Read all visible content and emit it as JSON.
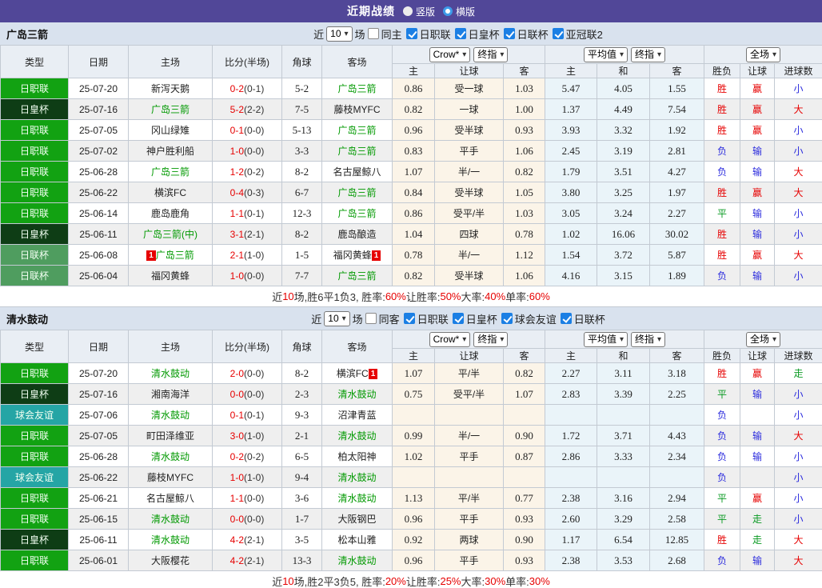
{
  "topbar": {
    "title": "近期战绩",
    "radio_selected_label": "竖版",
    "radio_unselected_label": "横版"
  },
  "columns": {
    "main": [
      "类型",
      "日期",
      "主场",
      "比分(半场)",
      "角球",
      "客场"
    ],
    "sub": [
      "主",
      "让球",
      "客",
      "主",
      "和",
      "客",
      "胜负",
      "让球",
      "进球数"
    ]
  },
  "badge_label": "1",
  "type_colors": {
    "日职联": "#12A212",
    "日皇杯": "#0E3D15",
    "日联杯": "#4F9D5F",
    "球会友谊": "#25A5A5"
  },
  "result_colors": {
    "r": "#E60000",
    "g": "#0A9A22",
    "b": "#2B2BDD"
  },
  "sections": [
    {
      "team": "广岛三箭",
      "filter": {
        "near_label": "近",
        "count": "10",
        "games_label": "场",
        "same_label": "同主",
        "same_checked": false,
        "leagues": [
          "日职联",
          "日皇杯",
          "日联杯",
          "亚冠联2"
        ]
      },
      "selects": {
        "odds": "Crow*",
        "odds_final": "终指",
        "avg": "平均值",
        "avg_final": "终指",
        "scope": "全场"
      },
      "rows": [
        {
          "t": "日职联",
          "d": "25-07-20",
          "h": "新泻天鹅",
          "hg": false,
          "hb": false,
          "s1": "0-2",
          "s2": "(0-1)",
          "c": "5-2",
          "a": "广岛三箭",
          "ag": true,
          "ab": false,
          "o": [
            "0.86",
            "受一球",
            "1.03"
          ],
          "v": [
            "5.47",
            "4.05",
            "1.55"
          ],
          "r": [
            [
              "胜",
              "r"
            ],
            [
              "赢",
              "r"
            ],
            [
              "小",
              "b"
            ]
          ]
        },
        {
          "t": "日皇杯",
          "d": "25-07-16",
          "h": "广岛三箭",
          "hg": true,
          "hb": false,
          "s1": "5-2",
          "s2": "(2-2)",
          "c": "7-5",
          "a": "藤枝MYFC",
          "ag": false,
          "ab": false,
          "o": [
            "0.82",
            "一球",
            "1.00"
          ],
          "v": [
            "1.37",
            "4.49",
            "7.54"
          ],
          "r": [
            [
              "胜",
              "r"
            ],
            [
              "赢",
              "r"
            ],
            [
              "大",
              "r"
            ]
          ]
        },
        {
          "t": "日职联",
          "d": "25-07-05",
          "h": "冈山绿雉",
          "hg": false,
          "hb": false,
          "s1": "0-1",
          "s2": "(0-0)",
          "c": "5-13",
          "a": "广岛三箭",
          "ag": true,
          "ab": false,
          "o": [
            "0.96",
            "受半球",
            "0.93"
          ],
          "v": [
            "3.93",
            "3.32",
            "1.92"
          ],
          "r": [
            [
              "胜",
              "r"
            ],
            [
              "赢",
              "r"
            ],
            [
              "小",
              "b"
            ]
          ]
        },
        {
          "t": "日职联",
          "d": "25-07-02",
          "h": "神户胜利船",
          "hg": false,
          "hb": false,
          "s1": "1-0",
          "s2": "(0-0)",
          "c": "3-3",
          "a": "广岛三箭",
          "ag": true,
          "ab": false,
          "o": [
            "0.83",
            "平手",
            "1.06"
          ],
          "v": [
            "2.45",
            "3.19",
            "2.81"
          ],
          "r": [
            [
              "负",
              "b"
            ],
            [
              "输",
              "b"
            ],
            [
              "小",
              "b"
            ]
          ]
        },
        {
          "t": "日职联",
          "d": "25-06-28",
          "h": "广岛三箭",
          "hg": true,
          "hb": false,
          "s1": "1-2",
          "s2": "(0-2)",
          "c": "8-2",
          "a": "名古屋鲸八",
          "ag": false,
          "ab": false,
          "o": [
            "1.07",
            "半/一",
            "0.82"
          ],
          "v": [
            "1.79",
            "3.51",
            "4.27"
          ],
          "r": [
            [
              "负",
              "b"
            ],
            [
              "输",
              "b"
            ],
            [
              "大",
              "r"
            ]
          ]
        },
        {
          "t": "日职联",
          "d": "25-06-22",
          "h": "横滨FC",
          "hg": false,
          "hb": false,
          "s1": "0-4",
          "s2": "(0-3)",
          "c": "6-7",
          "a": "广岛三箭",
          "ag": true,
          "ab": false,
          "o": [
            "0.84",
            "受半球",
            "1.05"
          ],
          "v": [
            "3.80",
            "3.25",
            "1.97"
          ],
          "r": [
            [
              "胜",
              "r"
            ],
            [
              "赢",
              "r"
            ],
            [
              "大",
              "r"
            ]
          ]
        },
        {
          "t": "日职联",
          "d": "25-06-14",
          "h": "鹿岛鹿角",
          "hg": false,
          "hb": false,
          "s1": "1-1",
          "s2": "(0-1)",
          "c": "12-3",
          "a": "广岛三箭",
          "ag": true,
          "ab": false,
          "o": [
            "0.86",
            "受平/半",
            "1.03"
          ],
          "v": [
            "3.05",
            "3.24",
            "2.27"
          ],
          "r": [
            [
              "平",
              "g"
            ],
            [
              "输",
              "b"
            ],
            [
              "小",
              "b"
            ]
          ]
        },
        {
          "t": "日皇杯",
          "d": "25-06-11",
          "h": "广岛三箭(中)",
          "hg": true,
          "hb": false,
          "s1": "3-1",
          "s2": "(2-1)",
          "c": "8-2",
          "a": "鹿岛酿造",
          "ag": false,
          "ab": false,
          "o": [
            "1.04",
            "四球",
            "0.78"
          ],
          "v": [
            "1.02",
            "16.06",
            "30.02"
          ],
          "r": [
            [
              "胜",
              "r"
            ],
            [
              "输",
              "b"
            ],
            [
              "小",
              "b"
            ]
          ]
        },
        {
          "t": "日联杯",
          "d": "25-06-08",
          "h": "广岛三箭",
          "hg": true,
          "hb": true,
          "s1": "2-1",
          "s2": "(1-0)",
          "c": "1-5",
          "a": "福冈黄蜂",
          "ag": false,
          "ab": true,
          "o": [
            "0.78",
            "半/一",
            "1.12"
          ],
          "v": [
            "1.54",
            "3.72",
            "5.87"
          ],
          "r": [
            [
              "胜",
              "r"
            ],
            [
              "赢",
              "r"
            ],
            [
              "大",
              "r"
            ]
          ]
        },
        {
          "t": "日联杯",
          "d": "25-06-04",
          "h": "福冈黄蜂",
          "hg": false,
          "hb": false,
          "s1": "1-0",
          "s2": "(0-0)",
          "c": "7-7",
          "a": "广岛三箭",
          "ag": true,
          "ab": false,
          "o": [
            "0.82",
            "受半球",
            "1.06"
          ],
          "v": [
            "4.16",
            "3.15",
            "1.89"
          ],
          "r": [
            [
              "负",
              "b"
            ],
            [
              "输",
              "b"
            ],
            [
              "小",
              "b"
            ]
          ]
        }
      ],
      "summary": [
        [
          "近",
          false
        ],
        [
          "10",
          true
        ],
        [
          "场,胜6平1负3, 胜率:",
          false
        ],
        [
          "60%",
          true
        ],
        [
          " 让胜率:",
          false
        ],
        [
          "50%",
          true
        ],
        [
          " 大率:",
          false
        ],
        [
          "40%",
          true
        ],
        [
          " 单率:",
          false
        ],
        [
          "60%",
          true
        ]
      ]
    },
    {
      "team": "清水鼓动",
      "filter": {
        "near_label": "近",
        "count": "10",
        "games_label": "场",
        "same_label": "同客",
        "same_checked": false,
        "leagues": [
          "日职联",
          "日皇杯",
          "球会友谊",
          "日联杯"
        ]
      },
      "selects": {
        "odds": "Crow*",
        "odds_final": "终指",
        "avg": "平均值",
        "avg_final": "终指",
        "scope": "全场"
      },
      "rows": [
        {
          "t": "日职联",
          "d": "25-07-20",
          "h": "清水鼓动",
          "hg": true,
          "hb": false,
          "s1": "2-0",
          "s2": "(0-0)",
          "c": "8-2",
          "a": "横滨FC",
          "ag": false,
          "ab": true,
          "o": [
            "1.07",
            "平/半",
            "0.82"
          ],
          "v": [
            "2.27",
            "3.11",
            "3.18"
          ],
          "r": [
            [
              "胜",
              "r"
            ],
            [
              "赢",
              "r"
            ],
            [
              "走",
              "g"
            ]
          ]
        },
        {
          "t": "日皇杯",
          "d": "25-07-16",
          "h": "湘南海洋",
          "hg": false,
          "hb": false,
          "s1": "0-0",
          "s2": "(0-0)",
          "c": "2-3",
          "a": "清水鼓动",
          "ag": true,
          "ab": false,
          "o": [
            "0.75",
            "受平/半",
            "1.07"
          ],
          "v": [
            "2.83",
            "3.39",
            "2.25"
          ],
          "r": [
            [
              "平",
              "g"
            ],
            [
              "输",
              "b"
            ],
            [
              "小",
              "b"
            ]
          ]
        },
        {
          "t": "球会友谊",
          "d": "25-07-06",
          "h": "清水鼓动",
          "hg": true,
          "hb": false,
          "s1": "0-1",
          "s2": "(0-1)",
          "c": "9-3",
          "a": "沼津青蓝",
          "ag": false,
          "ab": false,
          "o": [
            "",
            "",
            ""
          ],
          "v": [
            "",
            "",
            ""
          ],
          "r": [
            [
              "负",
              "b"
            ],
            null,
            [
              "小",
              "b"
            ]
          ]
        },
        {
          "t": "日职联",
          "d": "25-07-05",
          "h": "町田泽维亚",
          "hg": false,
          "hb": false,
          "s1": "3-0",
          "s2": "(1-0)",
          "c": "2-1",
          "a": "清水鼓动",
          "ag": true,
          "ab": false,
          "o": [
            "0.99",
            "半/一",
            "0.90"
          ],
          "v": [
            "1.72",
            "3.71",
            "4.43"
          ],
          "r": [
            [
              "负",
              "b"
            ],
            [
              "输",
              "b"
            ],
            [
              "大",
              "r"
            ]
          ]
        },
        {
          "t": "日职联",
          "d": "25-06-28",
          "h": "清水鼓动",
          "hg": true,
          "hb": false,
          "s1": "0-2",
          "s2": "(0-2)",
          "c": "6-5",
          "a": "柏太阳神",
          "ag": false,
          "ab": false,
          "o": [
            "1.02",
            "平手",
            "0.87"
          ],
          "v": [
            "2.86",
            "3.33",
            "2.34"
          ],
          "r": [
            [
              "负",
              "b"
            ],
            [
              "输",
              "b"
            ],
            [
              "小",
              "b"
            ]
          ]
        },
        {
          "t": "球会友谊",
          "d": "25-06-22",
          "h": "藤枝MYFC",
          "hg": false,
          "hb": false,
          "s1": "1-0",
          "s2": "(1-0)",
          "c": "9-4",
          "a": "清水鼓动",
          "ag": true,
          "ab": false,
          "o": [
            "",
            "",
            ""
          ],
          "v": [
            "",
            "",
            ""
          ],
          "r": [
            [
              "负",
              "b"
            ],
            null,
            [
              "小",
              "b"
            ]
          ]
        },
        {
          "t": "日职联",
          "d": "25-06-21",
          "h": "名古屋鲸八",
          "hg": false,
          "hb": false,
          "s1": "1-1",
          "s2": "(0-0)",
          "c": "3-6",
          "a": "清水鼓动",
          "ag": true,
          "ab": false,
          "o": [
            "1.13",
            "平/半",
            "0.77"
          ],
          "v": [
            "2.38",
            "3.16",
            "2.94"
          ],
          "r": [
            [
              "平",
              "g"
            ],
            [
              "赢",
              "r"
            ],
            [
              "小",
              "b"
            ]
          ]
        },
        {
          "t": "日职联",
          "d": "25-06-15",
          "h": "清水鼓动",
          "hg": true,
          "hb": false,
          "s1": "0-0",
          "s2": "(0-0)",
          "c": "1-7",
          "a": "大阪钢巴",
          "ag": false,
          "ab": false,
          "o": [
            "0.96",
            "平手",
            "0.93"
          ],
          "v": [
            "2.60",
            "3.29",
            "2.58"
          ],
          "r": [
            [
              "平",
              "g"
            ],
            [
              "走",
              "g"
            ],
            [
              "小",
              "b"
            ]
          ]
        },
        {
          "t": "日皇杯",
          "d": "25-06-11",
          "h": "清水鼓动",
          "hg": true,
          "hb": false,
          "s1": "4-2",
          "s2": "(2-1)",
          "c": "3-5",
          "a": "松本山雅",
          "ag": false,
          "ab": false,
          "o": [
            "0.92",
            "两球",
            "0.90"
          ],
          "v": [
            "1.17",
            "6.54",
            "12.85"
          ],
          "r": [
            [
              "胜",
              "r"
            ],
            [
              "走",
              "g"
            ],
            [
              "大",
              "r"
            ]
          ]
        },
        {
          "t": "日职联",
          "d": "25-06-01",
          "h": "大阪樱花",
          "hg": false,
          "hb": false,
          "s1": "4-2",
          "s2": "(2-1)",
          "c": "13-3",
          "a": "清水鼓动",
          "ag": true,
          "ab": false,
          "o": [
            "0.96",
            "平手",
            "0.93"
          ],
          "v": [
            "2.38",
            "3.53",
            "2.68"
          ],
          "r": [
            [
              "负",
              "b"
            ],
            [
              "输",
              "b"
            ],
            [
              "大",
              "r"
            ]
          ]
        }
      ],
      "summary": [
        [
          "近",
          false
        ],
        [
          "10",
          true
        ],
        [
          "场,胜2平3负5, 胜率:",
          false
        ],
        [
          "20%",
          true
        ],
        [
          " 让胜率:",
          false
        ],
        [
          "25%",
          true
        ],
        [
          " 大率:",
          false
        ],
        [
          "30%",
          true
        ],
        [
          " 单率:",
          false
        ],
        [
          "30%",
          true
        ]
      ]
    }
  ]
}
